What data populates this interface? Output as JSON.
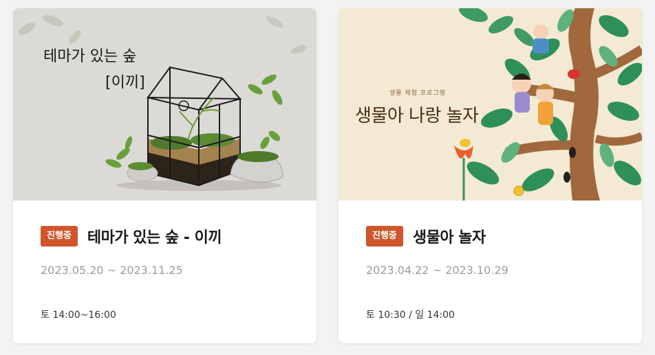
{
  "cards": [
    {
      "image_text": [
        "테마가 있는 숲",
        "[이끼]"
      ],
      "badge": "진행중",
      "title": "테마가 있는 숲 - 이끼",
      "date_range": "2023.05.20 ~ 2023.11.25",
      "schedule": "토 14:00~16:00"
    },
    {
      "image_subtitle": "생물 체험 프로그램",
      "image_title": "생물아 나랑 놀자",
      "badge": "진행중",
      "title": "생물아 놀자",
      "date_range": "2023.04.22 ~ 2023.10.29",
      "schedule": "토 10:30 / 일 14:00"
    }
  ],
  "colors": {
    "badge": "#d0552a",
    "date": "#9b9b9b"
  }
}
